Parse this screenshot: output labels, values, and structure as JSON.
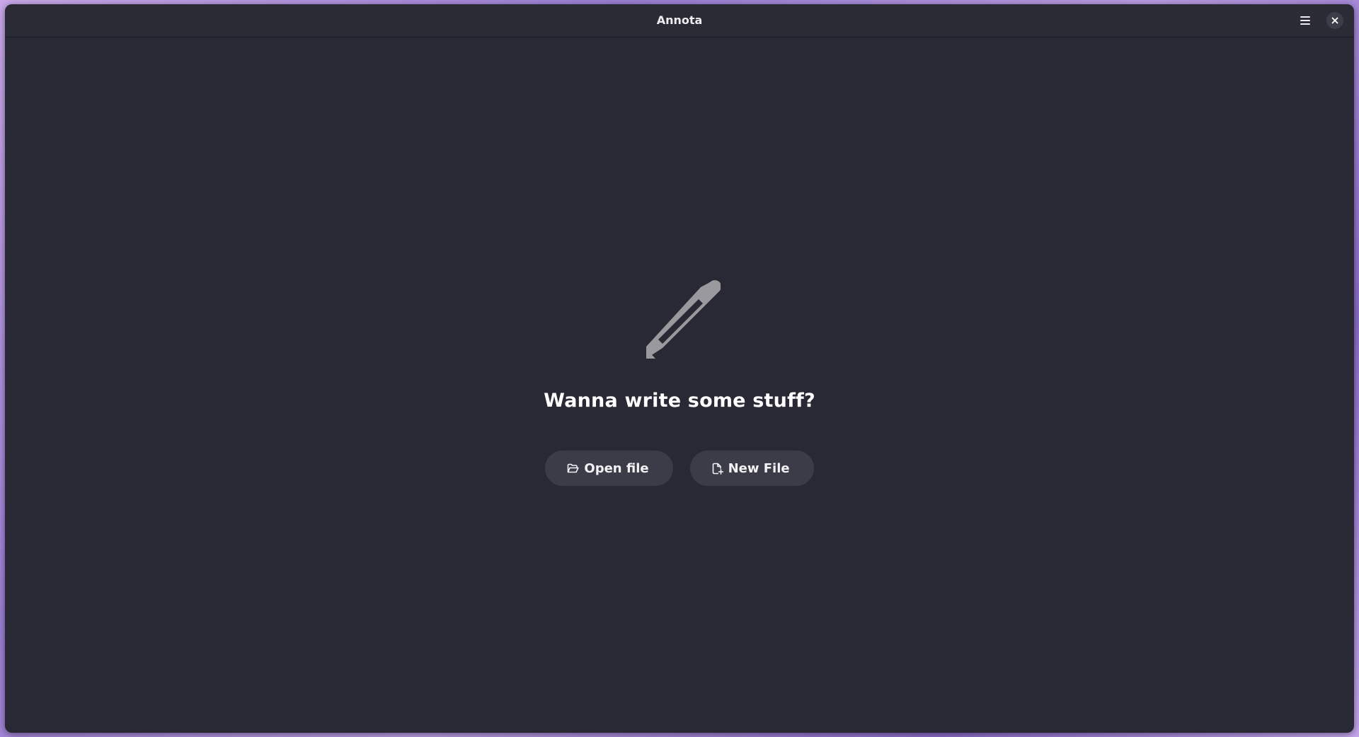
{
  "window": {
    "title": "Annota"
  },
  "header": {
    "menu_icon": "hamburger-menu-icon",
    "close_icon": "close-icon"
  },
  "empty_state": {
    "icon": "pencil-icon",
    "heading": "Wanna write some stuff?",
    "buttons": [
      {
        "label": "Open file",
        "icon": "folder-open-icon"
      },
      {
        "label": "New File",
        "icon": "document-new-icon"
      }
    ]
  },
  "colors": {
    "window_bg": "#282934",
    "button_bg": "#3b3c47",
    "icon_gray": "#9a9a9e"
  }
}
